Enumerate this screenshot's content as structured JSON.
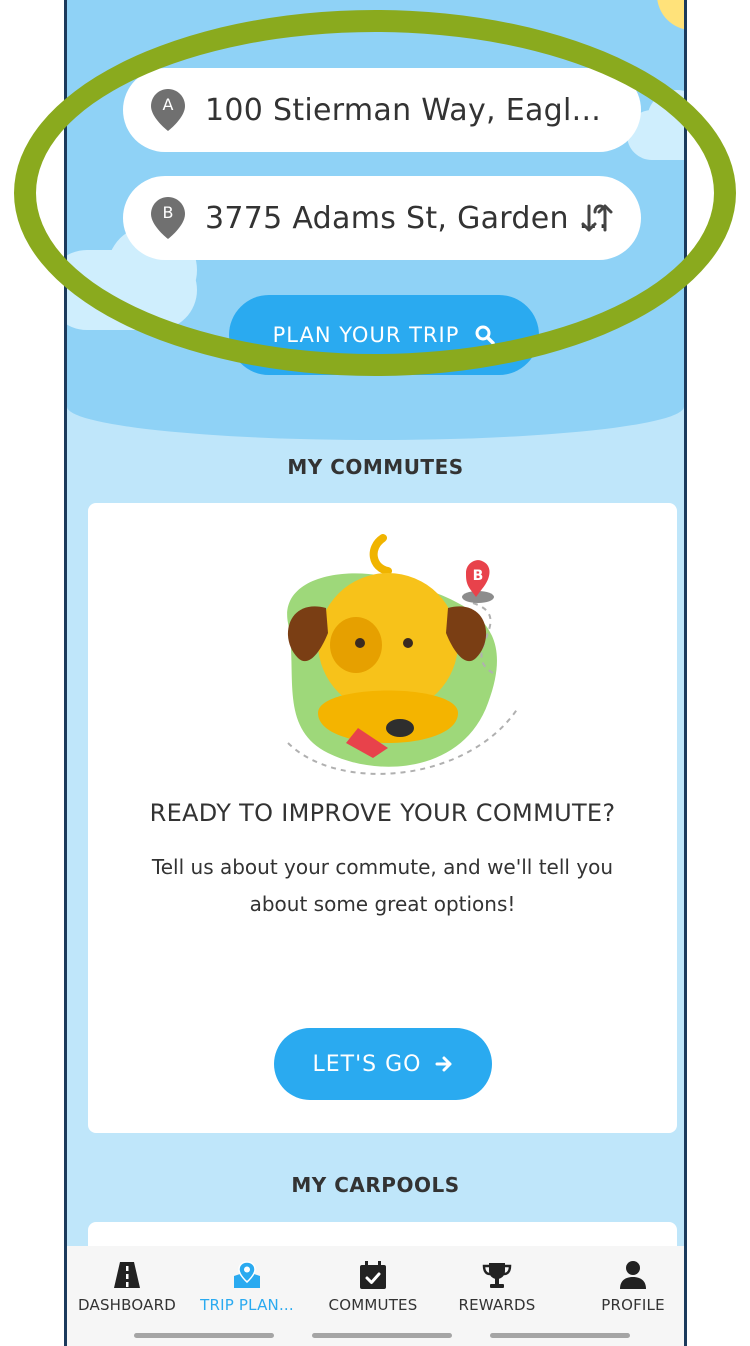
{
  "trip": {
    "origin_value": "100 Stierman Way, Eagl...",
    "origin_pin_label": "A",
    "destination_value": "3775 Adams St, Garden ...",
    "destination_pin_label": "B",
    "plan_button_label": "PLAN YOUR TRIP"
  },
  "commutes_section": {
    "title": "MY COMMUTES",
    "card_heading": "READY TO IMPROVE YOUR COMMUTE?",
    "card_body": "Tell us about your commute, and we'll tell you about some great options!",
    "cta_label": "LET'S GO",
    "illustration_pin_label": "B"
  },
  "carpools_section": {
    "title": "MY CARPOOLS"
  },
  "tabbar": {
    "items": [
      {
        "label": "DASHBOARD",
        "icon": "road-icon",
        "active": false
      },
      {
        "label": "TRIP PLAN...",
        "icon": "map-pin-icon",
        "active": true
      },
      {
        "label": "COMMUTES",
        "icon": "calendar-check-icon",
        "active": false
      },
      {
        "label": "REWARDS",
        "icon": "trophy-icon",
        "active": false
      },
      {
        "label": "PROFILE",
        "icon": "person-icon",
        "active": false
      }
    ]
  },
  "colors": {
    "accent": "#2aaaf0",
    "sky": "#8fd2f6",
    "background": "#bfe6fa",
    "highlight": "#8aaa1e"
  }
}
